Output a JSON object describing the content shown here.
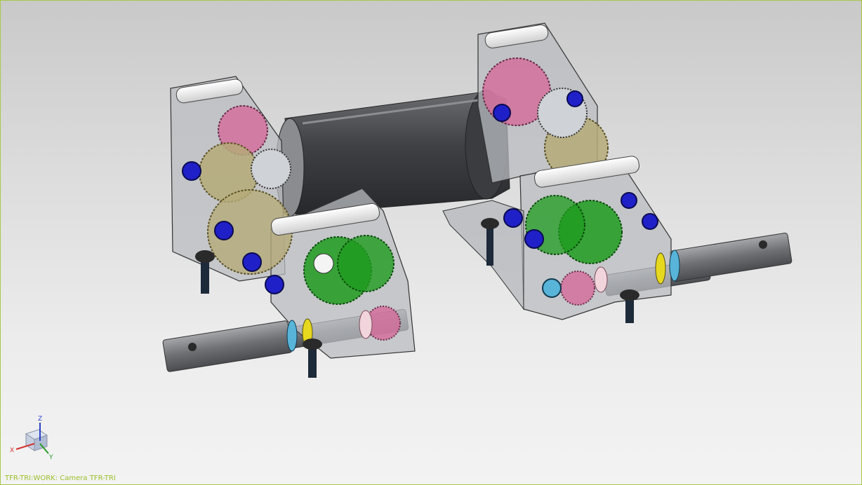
{
  "viewport": {
    "status_text": "TFR-TRI:WORK: Camera TFR-TRI",
    "background_top": "#c9c9c9",
    "background_bottom": "#f3f3f3",
    "border_color": "#a8c84a",
    "status_color": "#9bbf2a"
  },
  "triad": {
    "x_label": "X",
    "y_label": "Y",
    "z_label": "Z",
    "x_color": "#d33030",
    "y_color": "#2a9a2a",
    "z_color": "#2a40c8"
  },
  "model": {
    "colors": {
      "housing": "#b9bcc0",
      "motor": "#4a4c50",
      "shaft": "#7a7c80",
      "gear_green": "#1e9b1e",
      "gear_pink": "#d46a9a",
      "gear_gold": "#b5aa78",
      "bearing_blue": "#2020c8",
      "spacer_white": "#f4f4f4",
      "collar_yellow": "#e6d81e",
      "collar_cyan": "#58b4d8",
      "bolt": "#1c2a3a"
    }
  }
}
